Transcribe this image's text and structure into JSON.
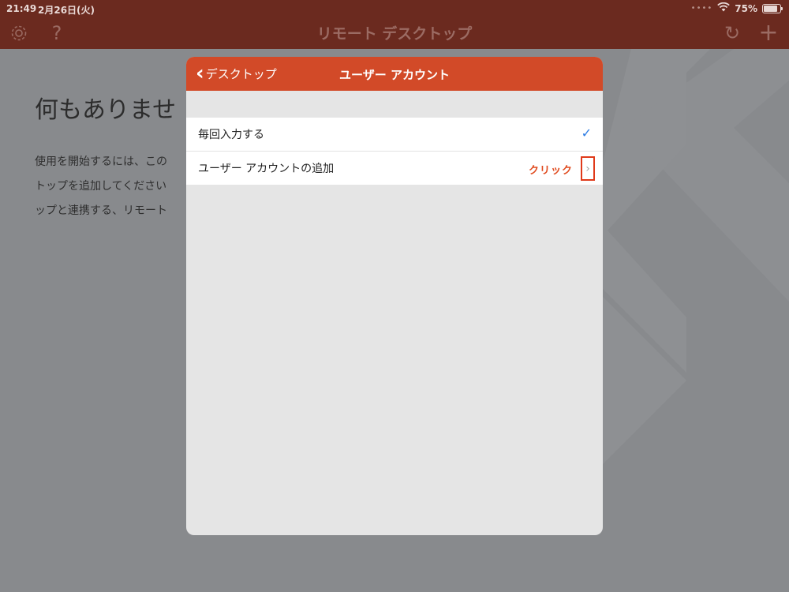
{
  "status_bar": {
    "time": "21:49",
    "date": "2月26日(火)",
    "dots": "••••",
    "wifi_icon": "wifi-icon",
    "battery_percent": "75%",
    "battery_level": 0.75
  },
  "navbar": {
    "title": "リモート デスクトップ",
    "settings_icon": "gear-icon",
    "help_icon": "?",
    "refresh_icon": "↻",
    "add_icon": "+"
  },
  "background": {
    "title": "何もありませ",
    "desc_line1": "使用を開始するには、この",
    "desc_line2": "トップを追加してください",
    "desc_line3": "ップと連携する、リモート"
  },
  "modal": {
    "back_label": "デスクトップ",
    "back_icon": "‹",
    "title": "ユーザー アカウント",
    "rows": [
      {
        "label": "毎回入力する",
        "check": "✓"
      },
      {
        "label": "ユーザー アカウントの追加",
        "annotation": "クリック",
        "disclosure": "›"
      }
    ]
  },
  "colors": {
    "header": "#d24a28",
    "topbar_dimmed": "#6b2a1f",
    "checkmark": "#2a7be4",
    "annotation": "#e04b1f"
  }
}
